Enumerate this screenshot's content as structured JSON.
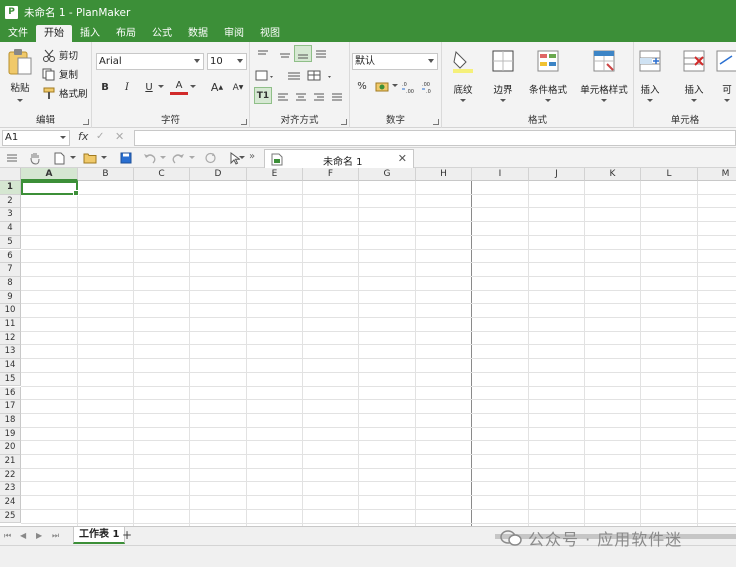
{
  "window": {
    "title": "未命名 1 - PlanMaker",
    "app_icon": "P"
  },
  "menu_tabs": [
    "文件",
    "开始",
    "插入",
    "布局",
    "公式",
    "数据",
    "审阅",
    "视图"
  ],
  "active_tab": "开始",
  "ribbon": {
    "clipboard": {
      "label": "编辑",
      "paste": "粘贴",
      "cut": "剪切",
      "copy": "复制",
      "format_painter": "格式刷"
    },
    "font": {
      "label": "字符",
      "font_name": "Arial",
      "font_size": "10",
      "bold": "B",
      "italic": "I",
      "underline": "U",
      "font_color": "A",
      "grow": "A",
      "shrink": "A"
    },
    "alignment": {
      "label": "对齐方式",
      "wrap": "T1"
    },
    "number": {
      "label": "数字",
      "format": "默认",
      "percent": "%"
    },
    "format": {
      "label": "格式",
      "shading": "底纹",
      "borders": "边界",
      "conditional": "条件格式",
      "cell_styles": "单元格样式"
    },
    "cells": {
      "label": "单元格",
      "insert1": "插入",
      "insert2": "插入",
      "visible": "可"
    }
  },
  "formula_bar": {
    "name_box": "A1",
    "fx": "fx",
    "confirm": "✓",
    "cancel": "✕",
    "value": ""
  },
  "document_tab": {
    "label": "未命名 1",
    "close": "✕"
  },
  "grid": {
    "columns": [
      "A",
      "B",
      "C",
      "D",
      "E",
      "F",
      "G",
      "H",
      "I",
      "J",
      "K",
      "L",
      "M"
    ],
    "rows": [
      "1",
      "2",
      "3",
      "4",
      "5",
      "6",
      "7",
      "8",
      "9",
      "10",
      "11",
      "12",
      "13",
      "14",
      "15",
      "16",
      "17",
      "18",
      "19",
      "20",
      "21",
      "22",
      "23",
      "24",
      "25"
    ],
    "selected_cell": "A1"
  },
  "sheets": {
    "tabs": [
      "工作表 1"
    ],
    "active": "工作表 1",
    "add": "+"
  },
  "watermark": {
    "text": "公众号 · 应用软件迷"
  },
  "colors": {
    "accent": "#3c8f38",
    "ribbon_bg": "#f3f3f3",
    "grid_line": "#e2e2e2"
  }
}
